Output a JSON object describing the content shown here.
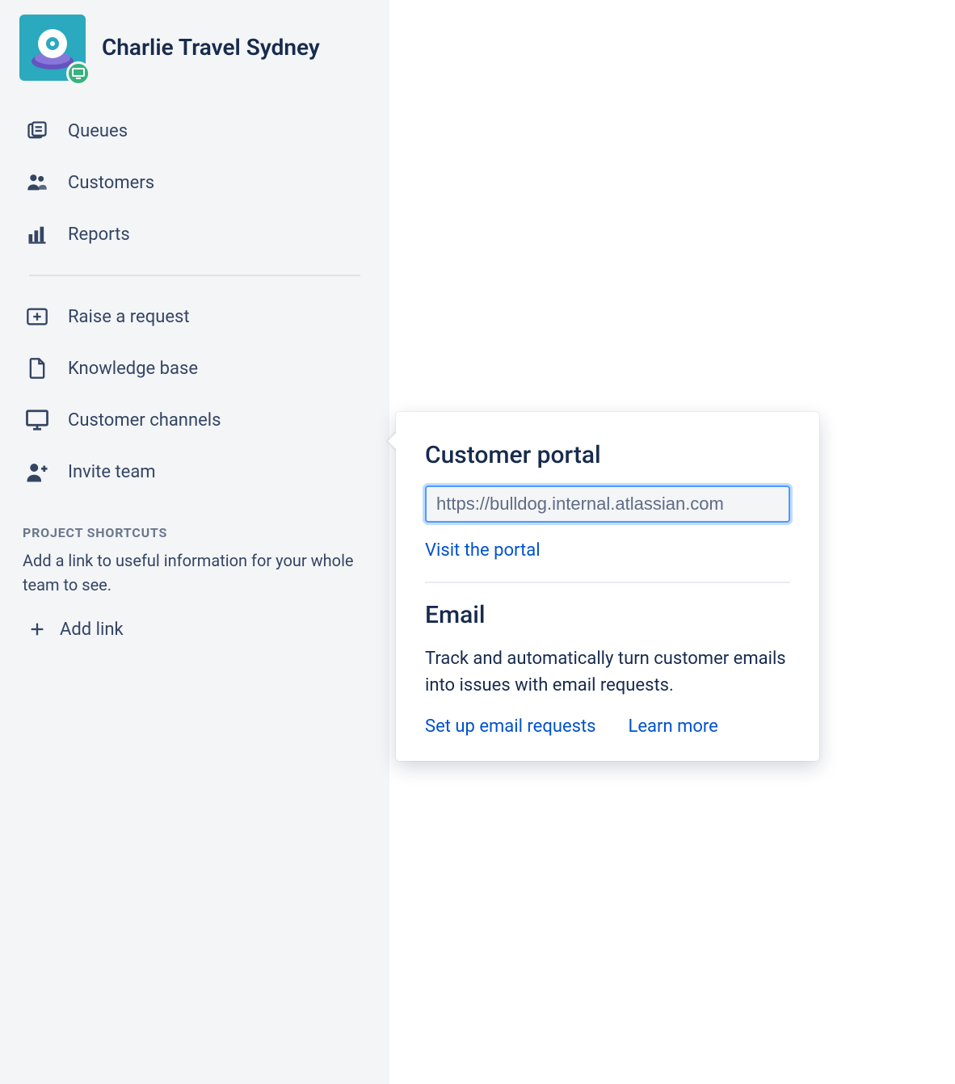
{
  "project": {
    "title": "Charlie Travel Sydney"
  },
  "nav": {
    "primary": [
      {
        "label": "Queues"
      },
      {
        "label": "Customers"
      },
      {
        "label": "Reports"
      }
    ],
    "secondary": [
      {
        "label": "Raise a request"
      },
      {
        "label": "Knowledge base"
      },
      {
        "label": "Customer channels"
      },
      {
        "label": "Invite team"
      }
    ]
  },
  "shortcuts": {
    "heading": "PROJECT SHORTCUTS",
    "description": "Add a link to useful information for your whole team to see.",
    "add_link_label": "Add link"
  },
  "popover": {
    "portal_heading": "Customer portal",
    "portal_url": "https://bulldog.internal.atlassian.com",
    "visit_label": "Visit the portal",
    "email_heading": "Email",
    "email_description": "Track and automatically turn customer emails into issues with email requests.",
    "setup_label": "Set up email requests",
    "learn_more_label": "Learn more"
  }
}
